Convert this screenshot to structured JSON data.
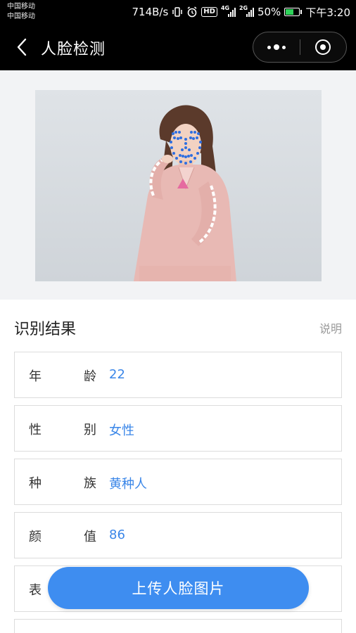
{
  "status_bar": {
    "carrier_1": "中国移动",
    "carrier_2": "中国移动",
    "net_speed": "714B/s",
    "hd_badge": "HD",
    "signal_1_tag": "4G",
    "signal_2_tag": "2G",
    "battery": "50%",
    "time": "下午3:20",
    "icons": [
      "vibrate-icon",
      "alarm-icon",
      "hd-icon",
      "signal-icon",
      "signal-icon",
      "battery-icon"
    ]
  },
  "nav": {
    "title": "人脸检测",
    "back_icon": "chevron-left-icon",
    "more_icon": "more-dots-icon",
    "close_icon": "target-close-icon"
  },
  "results": {
    "title": "识别结果",
    "explain": "说明",
    "rows": [
      {
        "label_a": "年",
        "label_b": "龄",
        "value": "22"
      },
      {
        "label_a": "性",
        "label_b": "别",
        "value": "女性"
      },
      {
        "label_a": "种",
        "label_b": "族",
        "value": "黄种人"
      },
      {
        "label_a": "颜",
        "label_b": "值",
        "value": "86"
      },
      {
        "label_a": "表",
        "label_b": "",
        "value": ""
      }
    ]
  },
  "upload_button": "上传人脸图片",
  "colors": {
    "accent": "#3e8df0",
    "value_text": "#3a86e8",
    "landmark": "#2f6fe0"
  }
}
